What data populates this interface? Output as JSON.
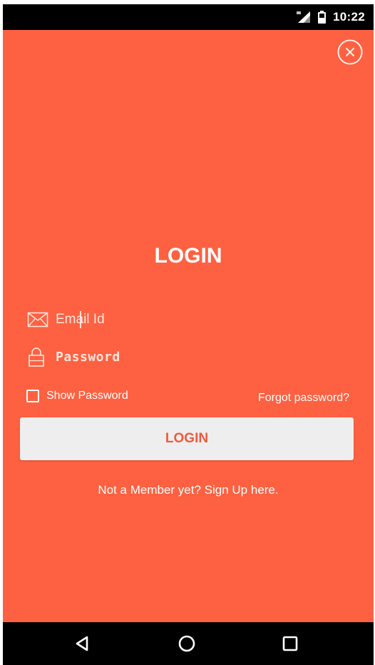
{
  "status_bar": {
    "time": "10:22",
    "icons": [
      "signal-icon",
      "battery-icon"
    ]
  },
  "screen": {
    "background": "#fe6141",
    "close_icon": "close-circle-icon",
    "title": "LOGIN"
  },
  "form": {
    "email": {
      "placeholder": "Email Id",
      "value": "",
      "icon": "envelope-icon"
    },
    "password": {
      "placeholder": "Password",
      "value": "",
      "icon": "lock-icon"
    },
    "show_password": {
      "label": "Show Password",
      "checked": false
    },
    "forgot_password": "Forgot password?",
    "login_button": "LOGIN",
    "signup_link": "Not a Member yet? Sign Up here."
  },
  "colors": {
    "accent": "#fe6141",
    "button_bg": "#eeeeee",
    "button_text": "#f05a3d"
  },
  "nav_bar": {
    "icons": [
      "back-triangle-icon",
      "home-circle-icon",
      "recents-square-icon"
    ]
  }
}
